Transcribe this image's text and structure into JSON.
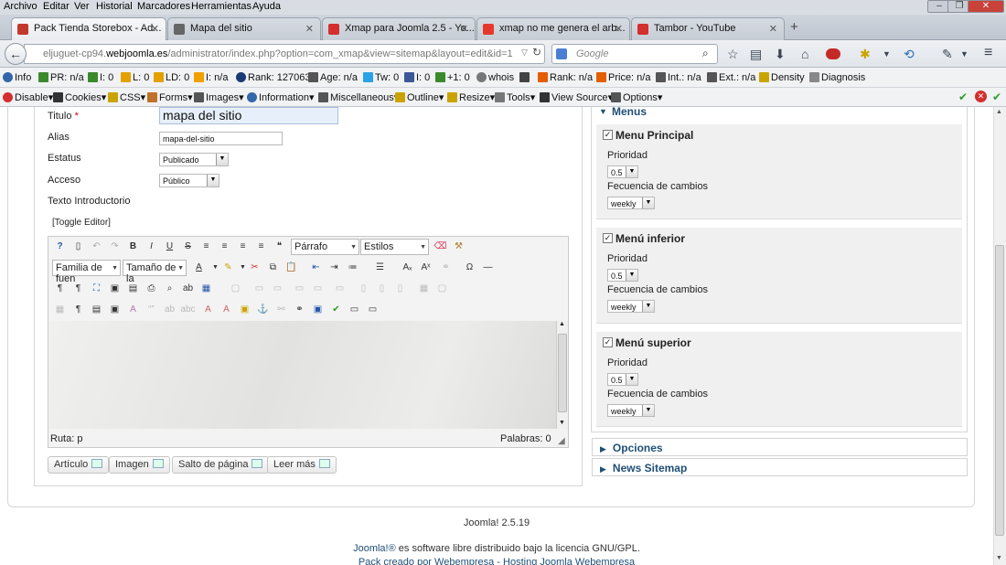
{
  "menu": [
    "Archivo",
    "Editar",
    "Ver",
    "Historial",
    "Marcadores",
    "Herramientas",
    "Ayuda"
  ],
  "tabs": [
    {
      "label": "Pack Tienda Storebox - Ad...",
      "color": "#c0392b"
    },
    {
      "label": "Mapa del sitio",
      "color": "#555"
    },
    {
      "label": "Xmap para Joomla 2.5 - Yo...",
      "color": "#d32f2f"
    },
    {
      "label": "xmap no me genera el arb...",
      "color": "#e5392c"
    },
    {
      "label": "Tambor - YouTube",
      "color": "#d32f2f"
    }
  ],
  "nav": {
    "url_prefix": "eljuguet-cp94.",
    "url_domain": "webjoomla.es",
    "url_rest": "/administrator/index.php?option=com_xmap&view=sitemap&layout=edit&id=1",
    "search_placeholder": "Google"
  },
  "seobar": [
    "Info",
    "PR: n/a",
    "I: 0",
    "L: 0",
    "LD: 0",
    "I: n/a",
    "Rank: 127063",
    "Age: n/a",
    "Tw: 0",
    "I: 0",
    "+1: 0",
    "whois",
    "Rank: n/a",
    "Price: n/a",
    "Int.: n/a",
    "Ext.: n/a",
    "Density",
    "Diagnosis"
  ],
  "webdev": [
    "Disable",
    "Cookies",
    "CSS",
    "Forms",
    "Images",
    "Information",
    "Miscellaneous",
    "Outline",
    "Resize",
    "Tools",
    "View Source",
    "Options"
  ],
  "form": {
    "titulo_label": "Titulo",
    "titulo_value": "mapa del sitio",
    "alias_label": "Alias",
    "alias_value": "mapa-del-sitio",
    "estatus_label": "Estatus",
    "estatus_value": "Publicado",
    "acceso_label": "Acceso",
    "acceso_value": "Público",
    "intro_label": "Texto Introductorio",
    "toggle_editor": "[Toggle Editor]"
  },
  "editor": {
    "format": "Párrafo",
    "styles": "Estilos",
    "font_family": "Familia de fuen",
    "font_size": "Tamaño de la",
    "path": "Ruta:  p",
    "words": "Palabras: 0"
  },
  "buttons": [
    "Artículo",
    "Imagen",
    "Salto de página",
    "Leer más"
  ],
  "right": {
    "menus_header": "Menus",
    "items": [
      {
        "name": "Menu Principal",
        "priority_label": "Prioridad",
        "priority": "0.5",
        "freq_label": "Fecuencia de cambios",
        "freq": "weekly"
      },
      {
        "name": "Menú inferior",
        "priority_label": "Prioridad",
        "priority": "0.5",
        "freq_label": "Fecuencia de cambios",
        "freq": "weekly"
      },
      {
        "name": "Menú superior",
        "priority_label": "Prioridad",
        "priority": "0.5",
        "freq_label": "Fecuencia de cambios",
        "freq": "weekly"
      }
    ],
    "opciones": "Opciones",
    "news": "News Sitemap"
  },
  "footer": {
    "version": "Joomla! 2.5.19",
    "license_link": "Joomla!®",
    "license_rest": " es software libre distribuido bajo la licencia GNU/GPL.",
    "credit": "Pack creado por Webempresa - Hosting Joomla Webempresa"
  }
}
